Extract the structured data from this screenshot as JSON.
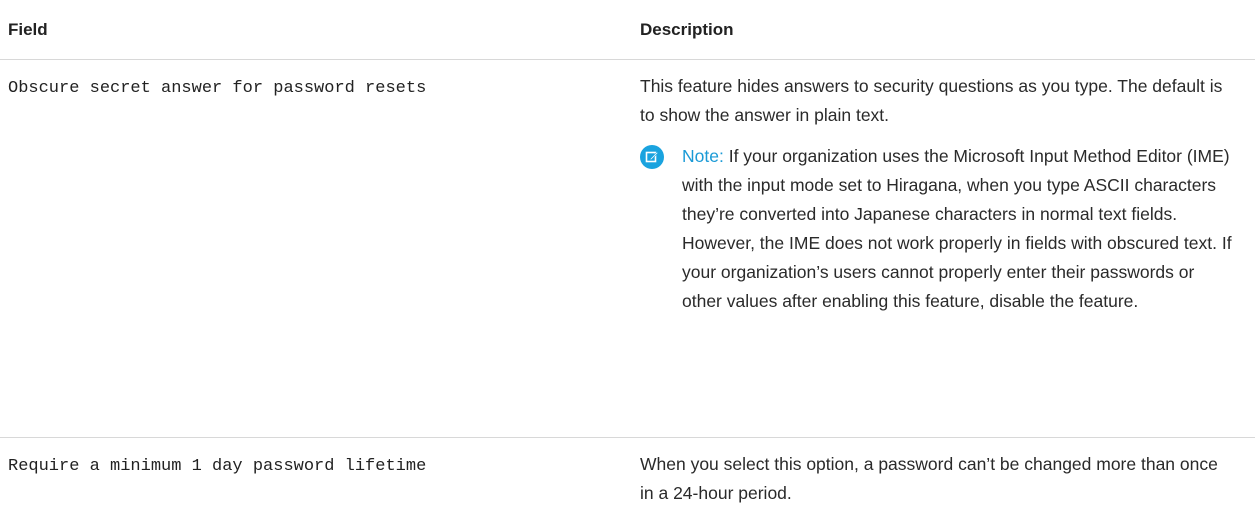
{
  "table": {
    "headers": {
      "field": "Field",
      "description": "Description"
    },
    "rows": [
      {
        "field": "Obscure secret answer for password resets",
        "description": "This feature hides answers to security questions as you type. The default is to show the answer in plain text.",
        "note": {
          "label": "Note:",
          "icon": "edit-note-icon",
          "text": "If your organization uses the Microsoft Input Method Editor (IME) with the input mode set to Hiragana, when you type ASCII characters they’re converted into Japanese characters in normal text fields. However, the IME does not work properly in fields with obscured text. If your organization’s users cannot properly enter their passwords or other values after enabling this feature, disable the feature."
        }
      },
      {
        "field": "Require a minimum 1 day password lifetime",
        "description": "When you select this option, a password can’t be changed more than once in a 24-hour period."
      }
    ]
  },
  "colors": {
    "note_accent": "#1aa3df",
    "divider": "#d8d8d8"
  }
}
